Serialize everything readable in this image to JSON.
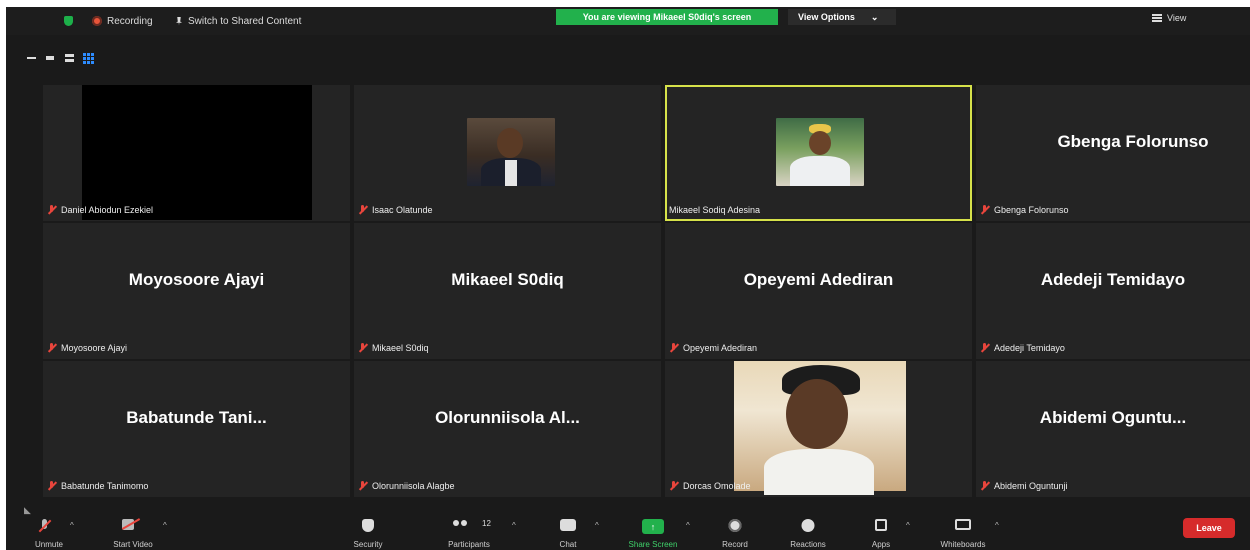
{
  "topbar": {
    "recording_label": "Recording",
    "switch_label": "Switch to Shared Content",
    "viewing_banner": "You are viewing Mikaeel S0diq's screen",
    "view_options": "View Options",
    "view_options_caret": "⌄",
    "view_label": "View"
  },
  "colors": {
    "accent_green": "#22b14c",
    "active_speaker": "#d6e24a",
    "muted_red": "#e8453c",
    "leave_red": "#d62b2b"
  },
  "tiles": [
    {
      "display_name": "",
      "label": "Daniel Abiodun Ezekiel",
      "video": "black"
    },
    {
      "display_name": "",
      "label": "Isaac Olatunde",
      "video": "photo"
    },
    {
      "display_name": "",
      "label": "Mikaeel Sodiq Adesina",
      "video": "photo",
      "active": true,
      "muted": false
    },
    {
      "display_name": "Gbenga Folorunso",
      "label": "Gbenga Folorunso"
    },
    {
      "display_name": "Moyosoore Ajayi",
      "label": "Moyosoore Ajayi"
    },
    {
      "display_name": "Mikaeel S0diq",
      "label": "Mikaeel S0diq"
    },
    {
      "display_name": "Opeyemi Adediran",
      "label": "Opeyemi Adediran"
    },
    {
      "display_name": "Adedeji Temidayo",
      "label": "Adedeji Temidayo"
    },
    {
      "display_name": "Babatunde Tani...",
      "label": "Babatunde Tanimomo"
    },
    {
      "display_name": "Olorunniisola Al...",
      "label": "Olorunniisola Alagbe"
    },
    {
      "display_name": "",
      "label": "Dorcas Omolade",
      "video": "photo"
    },
    {
      "display_name": "Abidemi Oguntu...",
      "label": "Abidemi Oguntunji"
    }
  ],
  "toolbar": {
    "unmute": "Unmute",
    "start_video": "Start Video",
    "security": "Security",
    "participants": "Participants",
    "participants_count": "12",
    "chat": "Chat",
    "share_screen": "Share Screen",
    "record": "Record",
    "reactions": "Reactions",
    "apps": "Apps",
    "whiteboards": "Whiteboards",
    "leave": "Leave",
    "caret": "^",
    "share_arrow": "↑"
  }
}
